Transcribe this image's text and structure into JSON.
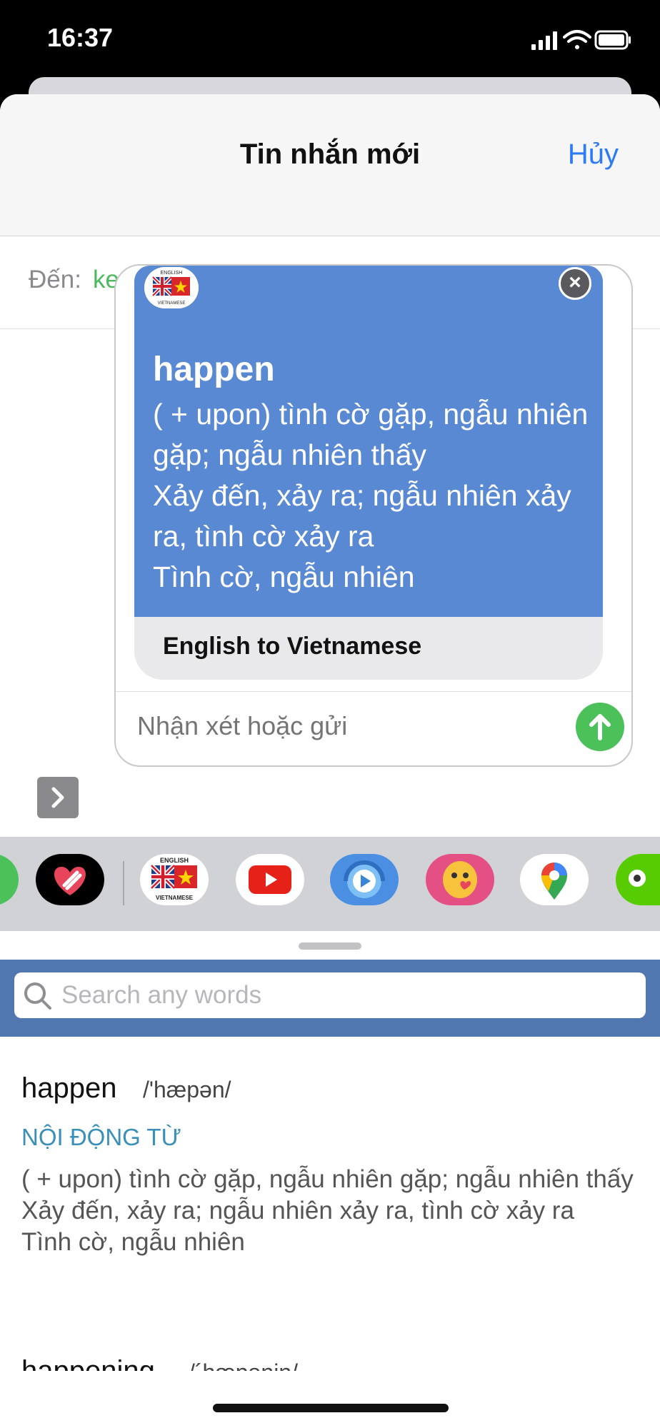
{
  "status": {
    "time": "16:37"
  },
  "nav": {
    "title": "Tin nhắn mới",
    "cancel": "Hủy"
  },
  "to": {
    "label": "Đến:",
    "recipient": "kevin"
  },
  "card": {
    "logo_top": "ENGLISH",
    "logo_bottom": "VIETNAMESE",
    "word": "happen",
    "meaning": "( + upon) tình cờ gặp, ngẫu nhiên gặp; ngẫu nhiên thấy\nXảy đến, xảy ra; ngẫu nhiên xảy ra, tình cờ xảy ra\nTình cờ, ngẫu nhiên",
    "footer": "English to Vietnamese",
    "close_icon": "close-icon"
  },
  "compose": {
    "placeholder": "Nhận xét hoặc gửi"
  },
  "apps": [
    {
      "name": "photos-app-icon"
    },
    {
      "name": "digital-touch-app-icon"
    },
    {
      "name": "english-vietnamese-app-icon",
      "label_top": "ENGLISH",
      "label_bottom": "VIETNAMESE"
    },
    {
      "name": "youtube-app-icon"
    },
    {
      "name": "music-app-icon"
    },
    {
      "name": "sticker-app-icon"
    },
    {
      "name": "google-maps-app-icon"
    },
    {
      "name": "duolingo-app-icon"
    }
  ],
  "panel": {
    "search_placeholder": "Search any words",
    "entries": [
      {
        "word": "happen",
        "phonetic": "/'hæpən/",
        "pos": "NỘI ĐỘNG TỪ",
        "definition": "( + upon) tình cờ gặp, ngẫu nhiên gặp; ngẫu nhiên thấy\nXảy đến, xảy ra; ngẫu nhiên xảy ra, tình cờ xảy ra\nTình cờ, ngẫu nhiên"
      },
      {
        "word": "happening",
        "phonetic": "/´hæpəniŋ/"
      }
    ]
  },
  "colors": {
    "accent_blue": "#2f7bf5",
    "recipient_green": "#4cba5f",
    "card_blue": "#5a89d4",
    "search_band": "#5077b0",
    "pos_color": "#3a8fb8",
    "send_green": "#4cc15a"
  }
}
